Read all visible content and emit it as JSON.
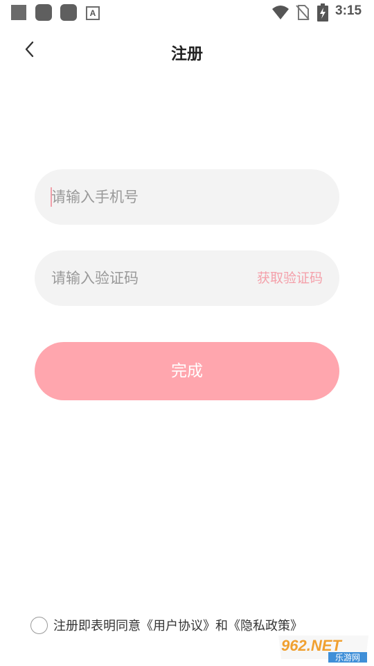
{
  "status_bar": {
    "time": "3:15",
    "notification_icons": [
      "square-icon",
      "app-icon",
      "app-icon",
      "font-a-icon"
    ],
    "system_icons": [
      "wifi-icon",
      "no-sim-icon",
      "battery-charging-icon"
    ]
  },
  "header": {
    "back_icon": "chevron-left-icon",
    "title": "注册"
  },
  "form": {
    "phone_placeholder": "请输入手机号",
    "code_placeholder": "请输入验证码",
    "get_code_label": "获取验证码",
    "submit_label": "完成"
  },
  "agreement": {
    "prefix": "注册即表明同意",
    "user_agreement": "《用户协议》",
    "conjunction": "和",
    "privacy_policy": "《隐私政策》",
    "checked": false
  },
  "watermark": {
    "brand": "962.NET",
    "subtitle": "乐游网"
  },
  "colors": {
    "accent": "#ffa6ae",
    "accent_text": "#f4a0aa",
    "field_bg": "#f3f3f3",
    "placeholder": "#999999"
  }
}
